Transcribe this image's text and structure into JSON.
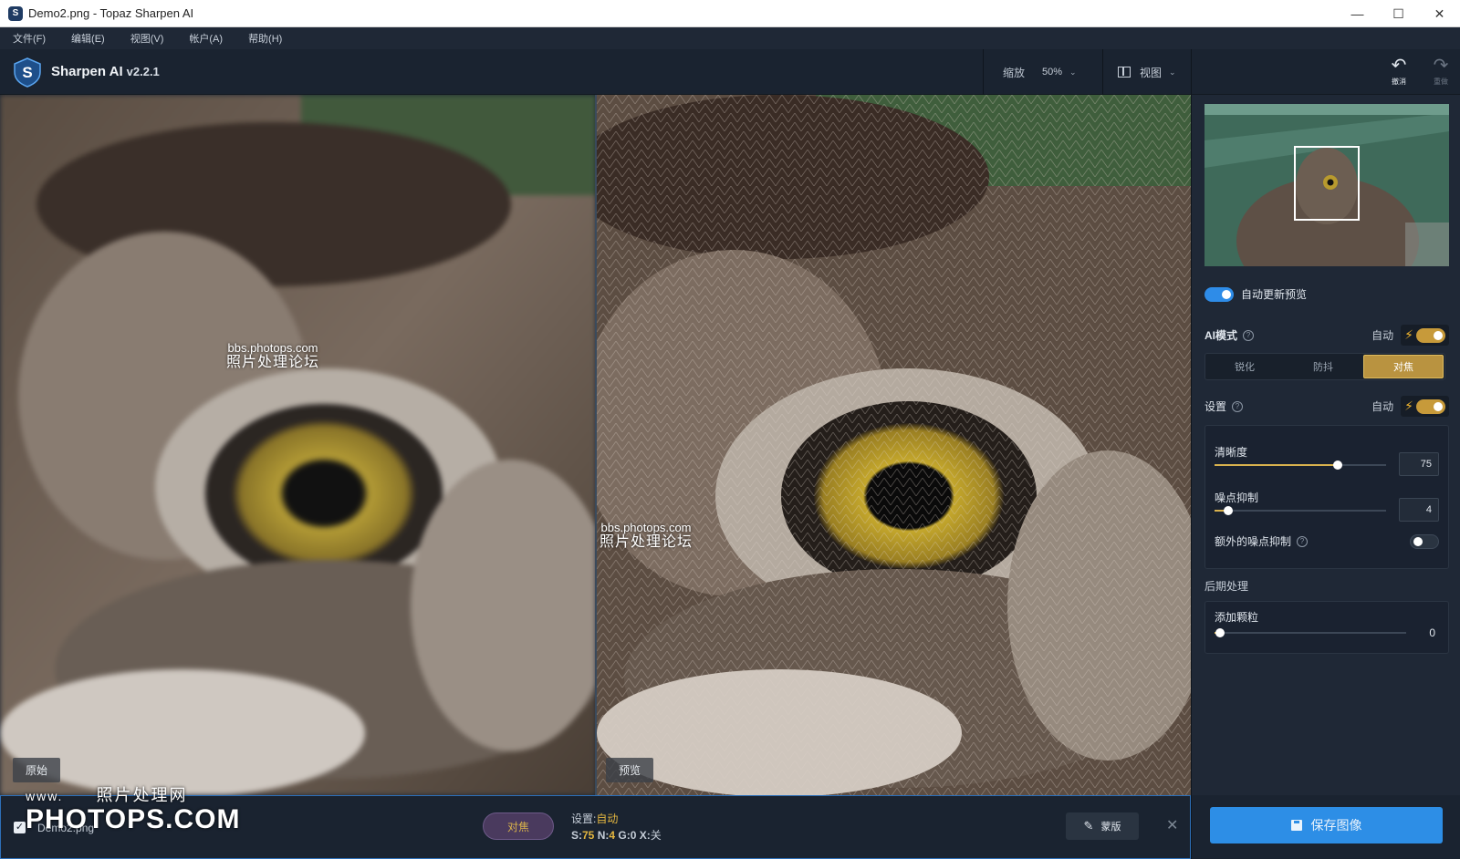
{
  "window": {
    "title": "Demo2.png - Topaz Sharpen AI",
    "controls": {
      "minimize": "—",
      "maximize": "☐",
      "close": "✕"
    }
  },
  "menu": [
    "文件(F)",
    "编辑(E)",
    "视图(V)",
    "帐户(A)",
    "帮助(H)"
  ],
  "toolbar": {
    "app_name": "Sharpen AI",
    "version": "v2.2.1",
    "zoom_label": "缩放",
    "zoom_value": "50%",
    "view_label": "视图",
    "undo_label": "撤消",
    "redo_label": "重做"
  },
  "viewer": {
    "left_tag": "原始",
    "right_tag": "预览",
    "watermark_url": "bbs.photops.com",
    "watermark_cn": "照片处理论坛"
  },
  "panel": {
    "auto_preview_label": "自动更新预览",
    "auto_preview_on": true,
    "ai_mode_label": "AI模式",
    "auto_label": "自动",
    "modes": [
      "锐化",
      "防抖",
      "对焦"
    ],
    "active_mode": 2,
    "settings_label": "设置",
    "sharpness_label": "清晰度",
    "sharpness_value": "75",
    "sharpness_fraction": 0.72,
    "noise_label": "噪点抑制",
    "noise_value": "4",
    "noise_fraction": 0.08,
    "extra_noise_label": "额外的噪点抑制",
    "extra_noise_on": false,
    "post_label": "后期处理",
    "grain_label": "添加颗粒",
    "grain_value": "0",
    "grain_fraction": 0.03
  },
  "filestrip": {
    "checked": true,
    "file_name": "Demo2.png",
    "mode_pill": "对焦",
    "settings_prefix": "设置:",
    "settings_value": "自动",
    "s_label": "S:",
    "s_value": "75",
    "n_label": "N:",
    "n_value": "4",
    "g_label": "G:",
    "g_value": "0",
    "x_label": "X:",
    "x_value": "关",
    "mask_label": "蒙版",
    "save_label": "保存图像"
  },
  "site_watermark": {
    "www": "www.",
    "cn": "照片处理网",
    "domain": "PHOTOPS.COM"
  },
  "colors": {
    "accent_blue": "#2d8ee6",
    "accent_gold": "#c79a3a",
    "panel_bg": "#1f2836"
  }
}
